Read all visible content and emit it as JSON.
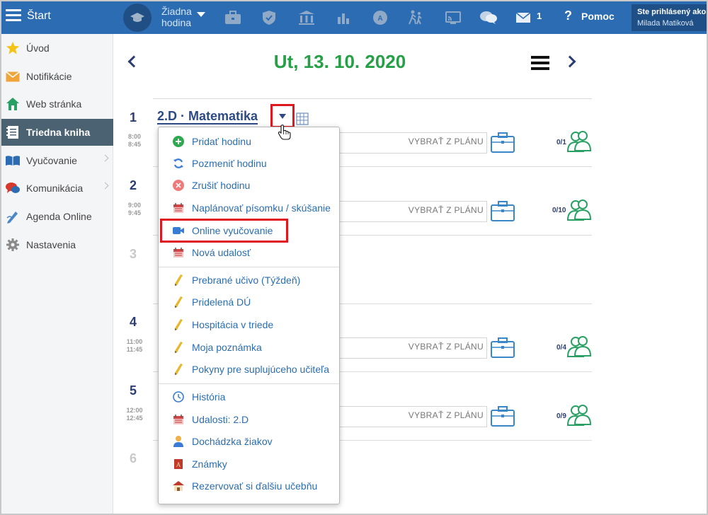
{
  "topbar": {
    "start_label": "Štart",
    "lesson_state_line1": "Žiadna",
    "lesson_state_line2": "hodina",
    "mail_count": "1",
    "help_label": "Pomoc",
    "user_line1": "Ste prihlásený ako",
    "user_line2": "Milada Matiková"
  },
  "sidebar": {
    "items": [
      {
        "label": "Úvod",
        "icon": "star-icon"
      },
      {
        "label": "Notifikácie",
        "icon": "envelope-icon"
      },
      {
        "label": "Web stránka",
        "icon": "house-icon"
      },
      {
        "label": "Triedna kniha",
        "icon": "notebook-icon"
      },
      {
        "label": "Vyučovanie",
        "icon": "book-icon"
      },
      {
        "label": "Komunikácia",
        "icon": "chat-icon"
      },
      {
        "label": "Agenda Online",
        "icon": "pen-icon"
      },
      {
        "label": "Nastavenia",
        "icon": "gear-icon"
      }
    ]
  },
  "main": {
    "date": "Ut, 13. 10. 2020",
    "lesson_title": "2.D · Matematika",
    "plan_label": "VYBRAŤ Z PLÁNU",
    "lessons": [
      {
        "num": "1",
        "time_start": "8:00",
        "time_end": "8:45",
        "count": "0/1"
      },
      {
        "num": "2",
        "time_start": "9:00",
        "time_end": "9:45",
        "count": "0/10"
      },
      {
        "num": "3"
      },
      {
        "num": "4",
        "time_start": "11:00",
        "time_end": "11:45",
        "count": "0/4"
      },
      {
        "num": "5",
        "time_start": "12:00",
        "time_end": "12:45",
        "count": "0/9"
      },
      {
        "num": "6"
      }
    ]
  },
  "dropdown": {
    "items": [
      {
        "label": "Pridať hodinu",
        "icon": "plus-circle-icon"
      },
      {
        "label": "Pozmeniť hodinu",
        "icon": "refresh-icon"
      },
      {
        "label": "Zrušiť hodinu",
        "icon": "cancel-circle-icon"
      },
      {
        "label": "Naplánovať písomku / skúšanie",
        "icon": "calendar-icon"
      },
      {
        "label": "Online vyučovanie",
        "icon": "video-camera-icon"
      },
      {
        "label": "Nová udalosť",
        "icon": "calendar-icon"
      },
      {
        "label": "Prebrané učivo (Týždeň)",
        "icon": "pencil-icon"
      },
      {
        "label": "Pridelená DÚ",
        "icon": "pencil-icon"
      },
      {
        "label": "Hospitácia v triede",
        "icon": "pencil-icon"
      },
      {
        "label": "Moja poznámka",
        "icon": "pencil-icon"
      },
      {
        "label": "Pokyny pre suplujúceho učiteľa",
        "icon": "pencil-icon"
      },
      {
        "label": "História",
        "icon": "clock-icon"
      },
      {
        "label": "Udalosti: 2.D",
        "icon": "calendar-icon"
      },
      {
        "label": "Dochádzka žiakov",
        "icon": "person-icon"
      },
      {
        "label": "Známky",
        "icon": "grade-book-icon"
      },
      {
        "label": "Rezervovať si ďalšiu učebňu",
        "icon": "house-icon"
      }
    ]
  }
}
